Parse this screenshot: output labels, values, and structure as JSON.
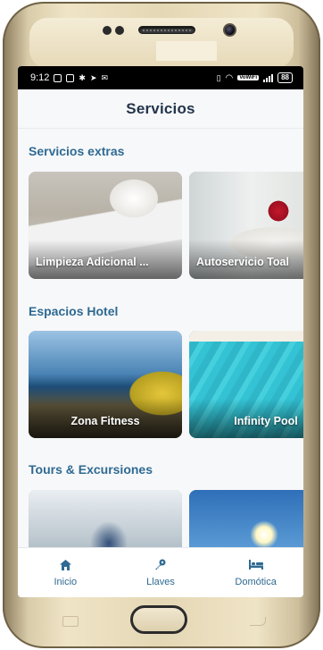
{
  "status_bar": {
    "time": "9:12",
    "wifi_badge": "VoWiFi",
    "battery": "88"
  },
  "header": {
    "title": "Servicios"
  },
  "sections": [
    {
      "title": "Servicios extras",
      "cards": [
        {
          "label": "Limpieza Adicional ...",
          "image": "cleaning-photo"
        },
        {
          "label": "Autoservicio Toal",
          "image": "towels-rose-photo"
        }
      ]
    },
    {
      "title": "Espacios Hotel",
      "cards": [
        {
          "label": "Zona Fitness",
          "image": "fitness-photo"
        },
        {
          "label": "Infinity Pool",
          "image": "pool-photo"
        }
      ]
    },
    {
      "title": "Tours & Excursiones",
      "cards": [
        {
          "label": "",
          "image": "indoor-skydiving-photo"
        },
        {
          "label": "",
          "image": "sun-sky-photo"
        }
      ]
    }
  ],
  "bottom_nav": [
    {
      "label": "Inicio",
      "icon": "home-icon"
    },
    {
      "label": "Llaves",
      "icon": "key-icon"
    },
    {
      "label": "Domótica",
      "icon": "bed-icon"
    }
  ],
  "colors": {
    "accent": "#2f6a92",
    "title": "#23354a",
    "background": "#f7f8fa"
  }
}
